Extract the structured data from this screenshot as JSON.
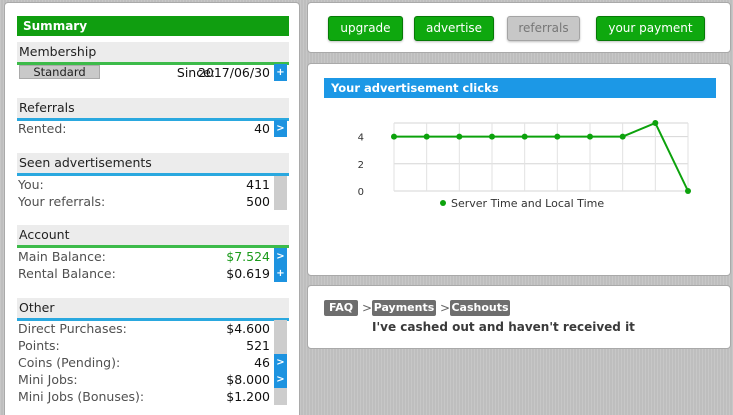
{
  "summary": {
    "title": "Summary",
    "membership": {
      "heading": "Membership",
      "level": "Standard",
      "since_label": "Since:",
      "since_date": "2017/06/30",
      "action": "+"
    },
    "referrals": {
      "heading": "Referrals",
      "rows": [
        {
          "label": "Rented:",
          "value": "40",
          "action": ">"
        }
      ]
    },
    "seen_ads": {
      "heading": "Seen advertisements",
      "rows": [
        {
          "label": "You:",
          "value": "411"
        },
        {
          "label": "Your referrals:",
          "value": "500"
        }
      ]
    },
    "account": {
      "heading": "Account",
      "rows": [
        {
          "label": "Main Balance:",
          "value": "$7.524",
          "action": ">"
        },
        {
          "label": "Rental Balance:",
          "value": "$0.619",
          "action": "+"
        }
      ]
    },
    "other": {
      "heading": "Other",
      "rows": [
        {
          "label": "Direct Purchases:",
          "value": "$4.600"
        },
        {
          "label": "Points:",
          "value": "521"
        },
        {
          "label": "Coins (Pending):",
          "value": "46",
          "action": ">"
        },
        {
          "label": "Mini Jobs:",
          "value": "$8.000",
          "action": ">"
        },
        {
          "label": "Mini Jobs (Bonuses):",
          "value": "$1.200"
        }
      ]
    }
  },
  "nav": {
    "buttons": [
      {
        "label": "upgrade"
      },
      {
        "label": "advertise"
      },
      {
        "label": "referrals"
      },
      {
        "label": "your payment"
      }
    ]
  },
  "chart_panel": {
    "title": "Your advertisement clicks"
  },
  "chart_data": {
    "type": "line",
    "series": [
      {
        "name": "Server Time and Local Time",
        "values": [
          4,
          4,
          4,
          4,
          4,
          4,
          4,
          4,
          5,
          0
        ],
        "color": "#0ca20c"
      }
    ],
    "y_ticks": [
      "0",
      "2",
      "4"
    ],
    "ylim": [
      0,
      5
    ],
    "grid": true,
    "legend": "bottom"
  },
  "faq": {
    "crumbs": [
      "FAQ",
      "Payments",
      "Cashouts"
    ],
    "separator": ">",
    "question": "I've cashed out and haven't received it"
  },
  "colors": {
    "green": "#109e10",
    "blue": "#1c98e6",
    "button_green": "#0ea80e"
  }
}
